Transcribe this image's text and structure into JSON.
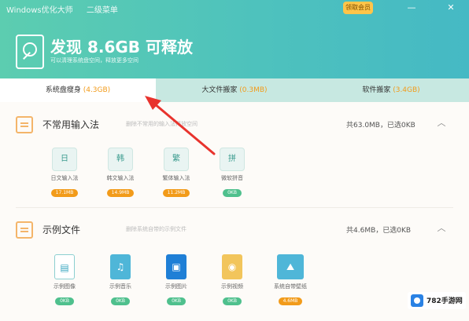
{
  "titlebar": {
    "app_name": "Windows优化大师",
    "secondary": "二级菜单",
    "vip_label": "领取会员"
  },
  "window": {
    "min_icon": "minimize-icon",
    "close_icon": "close-icon"
  },
  "header": {
    "headline": "发现 8.6GB 可释放",
    "subtext": "可以清理系统盘空间，释放更多空间"
  },
  "tabs": [
    {
      "label": "系统盘瘦身",
      "count": "(4.3GB)"
    },
    {
      "label": "大文件搬家",
      "count": "(0.3MB)"
    },
    {
      "label": "软件搬家",
      "count": "(3.4GB)"
    }
  ],
  "sections": [
    {
      "title": "不常用输入法",
      "desc": "删除不常用的输入法释放空间",
      "summary": "共63.0MB，已选0KB",
      "items": [
        {
          "label": "日文输入法",
          "size": "17.1MB",
          "icon": "日"
        },
        {
          "label": "韩文输入法",
          "size": "14.9MB",
          "icon": "韩"
        },
        {
          "label": "繁体输入法",
          "size": "11.2MB",
          "icon": "繁"
        },
        {
          "label": "微软拼音",
          "size": "0KB",
          "icon": "拼"
        }
      ]
    },
    {
      "title": "示例文件",
      "desc": "删除系统自带的示例文件",
      "summary": "共4.6MB，已选0KB",
      "items": [
        {
          "label": "示例图像",
          "size": "0KB",
          "icon": "doc"
        },
        {
          "label": "示例音乐",
          "size": "0KB",
          "icon": "music"
        },
        {
          "label": "示例图片",
          "size": "0KB",
          "icon": "pic"
        },
        {
          "label": "示例视频",
          "size": "0KB",
          "icon": "video"
        },
        {
          "label": "系统自带壁纸",
          "size": "4.6MB",
          "icon": "wall"
        }
      ]
    }
  ],
  "watermark": {
    "text": "782手游网"
  },
  "colors": {
    "header": "#4ec2bd",
    "accent": "#f29b1a",
    "green_tag": "#4fc08d",
    "arrow": "#e8332d"
  }
}
